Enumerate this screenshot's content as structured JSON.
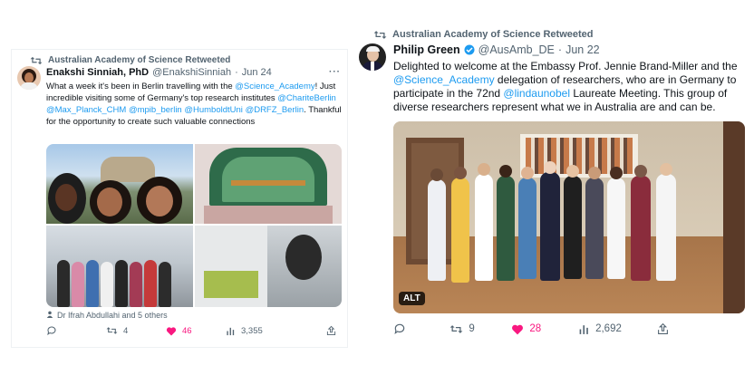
{
  "tweets": [
    {
      "retweet_label": "Australian Academy of Science Retweeted",
      "author_name": "Enakshi Sinniah, PhD",
      "handle": "@EnakshiSinniah",
      "separator": "·",
      "date": "Jun 24",
      "more": "···",
      "text": [
        {
          "t": "What a week it's been in Berlin travelling with the ",
          "m": false
        },
        {
          "t": "@Science_Academy",
          "m": true
        },
        {
          "t": "! Just incredible visiting some of Germany's top research institutes ",
          "m": false
        },
        {
          "t": "@ChariteBerlin",
          "m": true
        },
        {
          "t": " ",
          "m": false
        },
        {
          "t": "@Max_Planck_CHM",
          "m": true
        },
        {
          "t": " ",
          "m": false
        },
        {
          "t": "@mpib_berlin",
          "m": true
        },
        {
          "t": " ",
          "m": false
        },
        {
          "t": "@HumboldtUni",
          "m": true
        },
        {
          "t": " ",
          "m": false
        },
        {
          "t": "@DRFZ_Berlin",
          "m": true
        },
        {
          "t": ". Thankful for the opportunity to create such valuable connections",
          "m": false
        }
      ],
      "tagged": "Dr Ifrah Abdullahi and 5 others",
      "replies": "",
      "retweets": "4",
      "likes": "46",
      "views": "3,355",
      "share": ""
    },
    {
      "retweet_label": "Australian Academy of Science Retweeted",
      "author_name": "Philip Green",
      "handle": "@AusAmb_DE",
      "separator": "·",
      "date": "Jun 22",
      "text": [
        {
          "t": "Delighted to welcome at the Embassy Prof. Jennie Brand-Miller and the ",
          "m": false
        },
        {
          "t": "@Science_Academy",
          "m": true
        },
        {
          "t": " delegation of researchers, who are in Germany to participate in the 72nd ",
          "m": false
        },
        {
          "t": "@lindaunobel",
          "m": true
        },
        {
          "t": " Laureate Meeting. This group of diverse researchers represent what we in Australia are and can be.",
          "m": false
        }
      ],
      "alt": "ALT",
      "replies": "",
      "retweets": "9",
      "likes": "28",
      "views": "2,692",
      "share": ""
    }
  ],
  "colors": {
    "link": "#1d9bf0",
    "like": "#f91880",
    "muted": "#536471",
    "verified": "#1d9bf0"
  },
  "icons": [
    "retweet-icon",
    "verified-badge-icon",
    "more-icon",
    "reply-icon",
    "like-icon",
    "views-icon",
    "share-icon",
    "tagged-person-icon"
  ]
}
